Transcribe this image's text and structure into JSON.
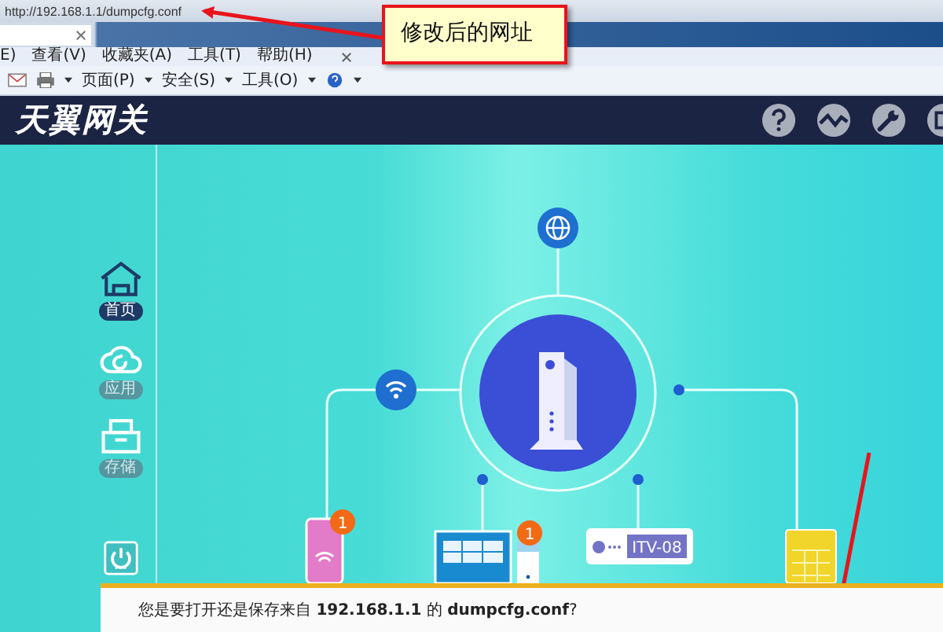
{
  "browser": {
    "address": "http://192.168.1.1/dumpcfg.conf",
    "menu": [
      "E)",
      "查看(V)",
      "收藏夹(A)",
      "工具(T)",
      "帮助(H)"
    ],
    "toolbar": [
      "页面(P)",
      "安全(S)",
      "工具(O)"
    ]
  },
  "annotation": {
    "text": "修改后的网址"
  },
  "header": {
    "logo": "天翼网关"
  },
  "sidebar": {
    "items": [
      {
        "label": "首页",
        "selected": true
      },
      {
        "label": "应用",
        "selected": false
      },
      {
        "label": "存储",
        "selected": false
      }
    ]
  },
  "diagram": {
    "devices": [
      {
        "kind": "phone",
        "badge": "1"
      },
      {
        "kind": "monitor"
      },
      {
        "kind": "tower",
        "badge": "1"
      },
      {
        "kind": "settop",
        "label": "ITV-08"
      },
      {
        "kind": "panel"
      }
    ]
  },
  "download_bar": {
    "message": "您是要打开还是保存来自 **192.168.1.1** 的 **dumpcfg.conf**?"
  }
}
